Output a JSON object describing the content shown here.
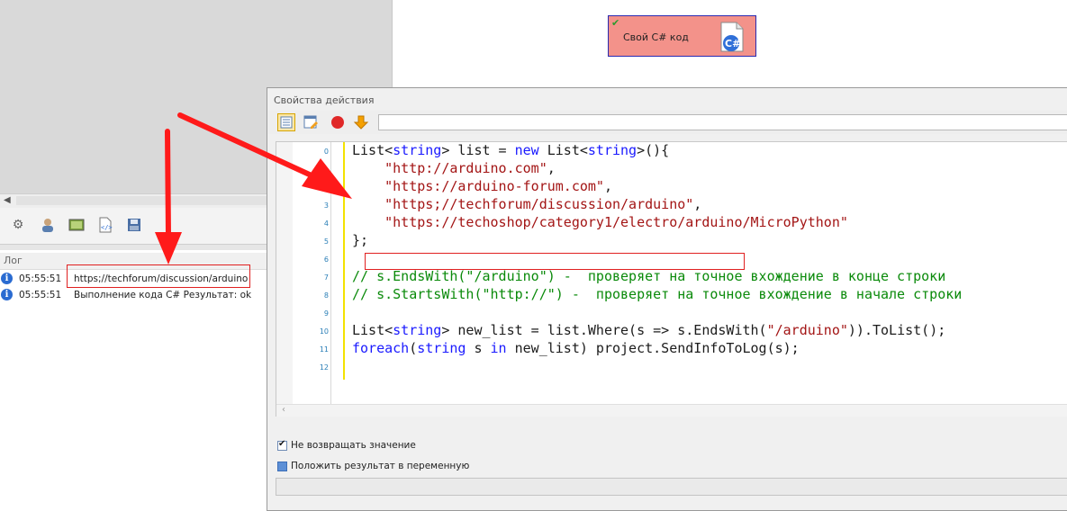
{
  "node": {
    "label": "Свой C# код",
    "file_badge": "C#"
  },
  "log": {
    "title": "Лог",
    "rows": [
      {
        "time": "05:55:51",
        "message": "https;//techforum/discussion/arduino"
      },
      {
        "time": "05:55:51",
        "message": "Выполнение кода C#  Результат: ok"
      }
    ]
  },
  "props": {
    "title": "Свойства действия",
    "code_lines": [
      {
        "num": "0"
      },
      {
        "num": "1"
      },
      {
        "num": "2"
      },
      {
        "num": "3"
      },
      {
        "num": "4"
      },
      {
        "num": "5"
      },
      {
        "num": "6"
      },
      {
        "num": "7"
      },
      {
        "num": "8"
      },
      {
        "num": "9"
      },
      {
        "num": "10"
      },
      {
        "num": "11"
      },
      {
        "num": "12"
      }
    ],
    "code": {
      "l0_a": "List<",
      "l0_b": "string",
      "l0_c": "> list = ",
      "l0_d": "new",
      "l0_e": " List<",
      "l0_f": "string",
      "l0_g": ">(){",
      "l1": "\"http://arduino.com\"",
      "l1_end": ",",
      "l2": "\"https://arduino-forum.com\"",
      "l2_end": ",",
      "l3": "\"https;//techforum/discussion/arduino\"",
      "l3_end": ",",
      "l4": "\"https://techoshop/category1/electro/arduino/MicroPython\"",
      "l5": "};",
      "l7": "// s.EndsWith(\"/arduino\") -  проверяет на точное вхождение в конце строки",
      "l8": "// s.StartsWith(\"http://\") -  проверяет на точное вхождение в начале строки",
      "l10_a": "List<",
      "l10_b": "string",
      "l10_c": "> new_list = list.Where(s => s.EndsWith(",
      "l10_d": "\"/arduino\"",
      "l10_e": ")).ToList();",
      "l11_a": "foreach",
      "l11_b": "(",
      "l11_c": "string",
      "l11_d": " s ",
      "l11_e": "in",
      "l11_f": " new_list) project.SendInfoToLog(s);"
    },
    "checkbox_no_return": {
      "label": "Не возвращать значение",
      "checked": true
    },
    "checkbox_put_result": {
      "label": "Положить результат в переменную",
      "checked": false
    }
  },
  "colors": {
    "node_fill": "#f3928a",
    "arrow": "#ff1a1a",
    "keyword": "#1a1aff",
    "string": "#a31515",
    "comment": "#0a8a0a"
  }
}
